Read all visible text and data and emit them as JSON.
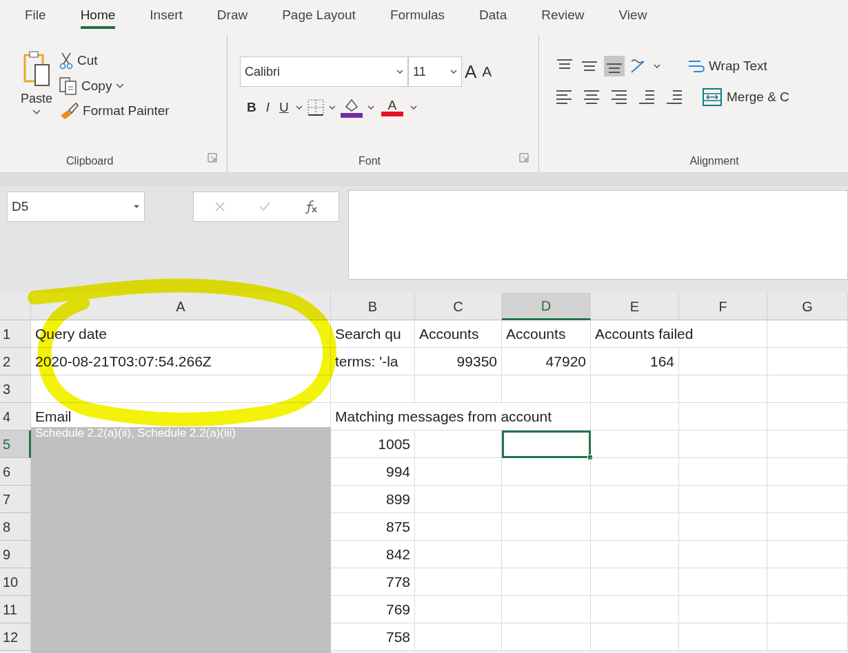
{
  "ribbon_tabs": [
    {
      "label": "File",
      "selected": false
    },
    {
      "label": "Home",
      "selected": true
    },
    {
      "label": "Insert",
      "selected": false
    },
    {
      "label": "Draw",
      "selected": false
    },
    {
      "label": "Page Layout",
      "selected": false
    },
    {
      "label": "Formulas",
      "selected": false
    },
    {
      "label": "Data",
      "selected": false
    },
    {
      "label": "Review",
      "selected": false
    },
    {
      "label": "View",
      "selected": false
    }
  ],
  "clipboard": {
    "paste": "Paste",
    "cut": "Cut",
    "copy": "Copy",
    "format_painter": "Format Painter",
    "group_label": "Clipboard"
  },
  "font": {
    "font_name": "Calibri",
    "font_size": "11",
    "grow": "A",
    "shrink": "A",
    "bold": "B",
    "italic": "I",
    "underline": "U",
    "font_color_letter": "A",
    "group_label": "Font"
  },
  "alignment": {
    "vertical": [
      {
        "kind": "top",
        "selected": false
      },
      {
        "kind": "middle",
        "selected": false
      },
      {
        "kind": "bottom",
        "selected": true
      }
    ],
    "wrap_text": "Wrap Text",
    "merge": "Merge & C",
    "group_label": "Alignment"
  },
  "formula_bar": {
    "name_box": "D5"
  },
  "sheet": {
    "columns": [
      {
        "label": "A",
        "selected": false
      },
      {
        "label": "B",
        "selected": false
      },
      {
        "label": "C",
        "selected": false
      },
      {
        "label": "D",
        "selected": true
      },
      {
        "label": "E",
        "selected": false
      },
      {
        "label": "F",
        "selected": false
      },
      {
        "label": "G",
        "selected": false
      }
    ],
    "rows": [
      {
        "number": "1",
        "selected": false,
        "cells": [
          {
            "text": "Query date",
            "kind": "text",
            "selected": false
          },
          {
            "text": "Search qu",
            "kind": "text",
            "selected": false
          },
          {
            "text": "Accounts",
            "kind": "text",
            "selected": false
          },
          {
            "text": "Accounts",
            "kind": "text",
            "selected": false
          },
          {
            "text": "Accounts failed",
            "kind": "text",
            "selected": false
          },
          null,
          null
        ]
      },
      {
        "number": "2",
        "selected": false,
        "cells": [
          {
            "text": "2020-08-21T03:07:54.266Z",
            "kind": "text",
            "selected": false
          },
          {
            "text": "terms: '-la",
            "kind": "text",
            "selected": false
          },
          {
            "text": "99350",
            "kind": "number",
            "selected": false
          },
          {
            "text": "47920",
            "kind": "number",
            "selected": false
          },
          {
            "text": "164",
            "kind": "number",
            "selected": false
          },
          null,
          null
        ]
      },
      {
        "number": "3",
        "selected": false,
        "cells": [
          null,
          null,
          null,
          null,
          null,
          null,
          null
        ]
      },
      {
        "number": "4",
        "selected": false,
        "cells": [
          {
            "text": "Email",
            "kind": "text",
            "selected": false
          },
          {
            "text": "Matching messages from account",
            "kind": "text",
            "selected": false
          },
          null,
          null,
          null,
          null,
          null
        ]
      },
      {
        "number": "5",
        "selected": true,
        "cells": [
          null,
          {
            "text": "1005",
            "kind": "number",
            "selected": false
          },
          null,
          {
            "kind": "empty",
            "selected": true
          },
          null,
          null,
          null
        ]
      },
      {
        "number": "6",
        "selected": false,
        "cells": [
          null,
          {
            "text": "994",
            "kind": "number",
            "selected": false
          },
          null,
          null,
          null,
          null,
          null
        ]
      },
      {
        "number": "7",
        "selected": false,
        "cells": [
          null,
          {
            "text": "899",
            "kind": "number",
            "selected": false
          },
          null,
          null,
          null,
          null,
          null
        ]
      },
      {
        "number": "8",
        "selected": false,
        "cells": [
          null,
          {
            "text": "875",
            "kind": "number",
            "selected": false
          },
          null,
          null,
          null,
          null,
          null
        ]
      },
      {
        "number": "9",
        "selected": false,
        "cells": [
          null,
          {
            "text": "842",
            "kind": "number",
            "selected": false
          },
          null,
          null,
          null,
          null,
          null
        ]
      },
      {
        "number": "10",
        "selected": false,
        "cells": [
          null,
          {
            "text": "778",
            "kind": "number",
            "selected": false
          },
          null,
          null,
          null,
          null,
          null
        ]
      },
      {
        "number": "11",
        "selected": false,
        "cells": [
          null,
          {
            "text": "769",
            "kind": "number",
            "selected": false
          },
          null,
          null,
          null,
          null,
          null
        ]
      },
      {
        "number": "12",
        "selected": false,
        "cells": [
          null,
          {
            "text": "758",
            "kind": "number",
            "selected": false
          },
          null,
          null,
          null,
          null,
          null
        ]
      }
    ],
    "redaction": {
      "label": "Schedule 2.2(a)(ii), Schedule 2.2(a)(iii)"
    },
    "annotation": {
      "kind": "highlighter-circle"
    }
  }
}
